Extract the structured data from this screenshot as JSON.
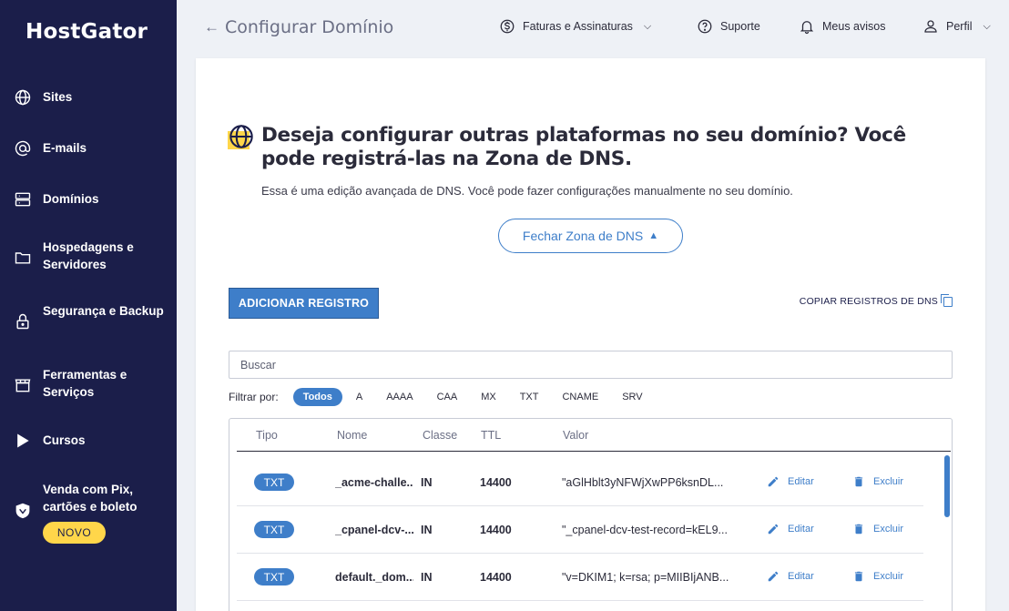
{
  "brand": {
    "logo": "HostGator"
  },
  "sidebar": {
    "items": [
      {
        "label": "Sites",
        "icon": "globe-icon"
      },
      {
        "label": "E-mails",
        "icon": "at-sign-icon"
      },
      {
        "label": "Domínios",
        "icon": "server-icon"
      },
      {
        "label": "Hospedagens e Servidores",
        "icon": "folder-icon"
      },
      {
        "label": "Segurança e Backup",
        "icon": "lock-icon"
      },
      {
        "label": "Ferramentas e Serviços",
        "icon": "store-icon"
      },
      {
        "label": "Cursos",
        "icon": "play-icon"
      },
      {
        "label": "Venda com Pix, cartões e boleto",
        "icon": "shield-icon"
      }
    ],
    "new_badge": "NOVO"
  },
  "topbar": {
    "back_icon": "arrow-left-icon",
    "title": "Configurar Domínio",
    "invoices": "Faturas e Assinaturas",
    "support": "Suporte",
    "notices": "Meus avisos",
    "profile": "Perfil"
  },
  "dns": {
    "heading": "Deseja configurar outras plataformas no seu domínio? Você pode registrá-las na Zona de DNS.",
    "subtext": "Essa é uma edição avançada de DNS. Você pode fazer configurações manualmente no seu domínio.",
    "close_button": "Fechar Zona de DNS",
    "add_button": "ADICIONAR REGISTRO",
    "copy_link": "COPIAR REGISTROS DE DNS",
    "search_placeholder": "Buscar",
    "filter_label": "Filtrar por:",
    "filters": [
      "Todos",
      "A",
      "AAAA",
      "CAA",
      "MX",
      "TXT",
      "CNAME",
      "SRV"
    ],
    "active_filter": "Todos",
    "columns": {
      "type": "Tipo",
      "name": "Nome",
      "class": "Classe",
      "ttl": "TTL",
      "value": "Valor"
    },
    "edit_label": "Editar",
    "delete_label": "Excluir",
    "rows": [
      {
        "type": "TXT",
        "name": "_acme-challe...",
        "class": "IN",
        "ttl": "14400",
        "value": "\"aGlHblt3yNFWjXwPP6ksnDL..."
      },
      {
        "type": "TXT",
        "name": "_cpanel-dcv-...",
        "class": "IN",
        "ttl": "14400",
        "value": "\"_cpanel-dcv-test-record=kEL9..."
      },
      {
        "type": "TXT",
        "name": "default._dom...",
        "class": "IN",
        "ttl": "14400",
        "value": "\"v=DKIM1; k=rsa; p=MIIBIjANB..."
      }
    ]
  },
  "colors": {
    "sidebar": "#1b1e4a",
    "accent": "#3e7ec9",
    "highlight": "#ffd64a"
  }
}
